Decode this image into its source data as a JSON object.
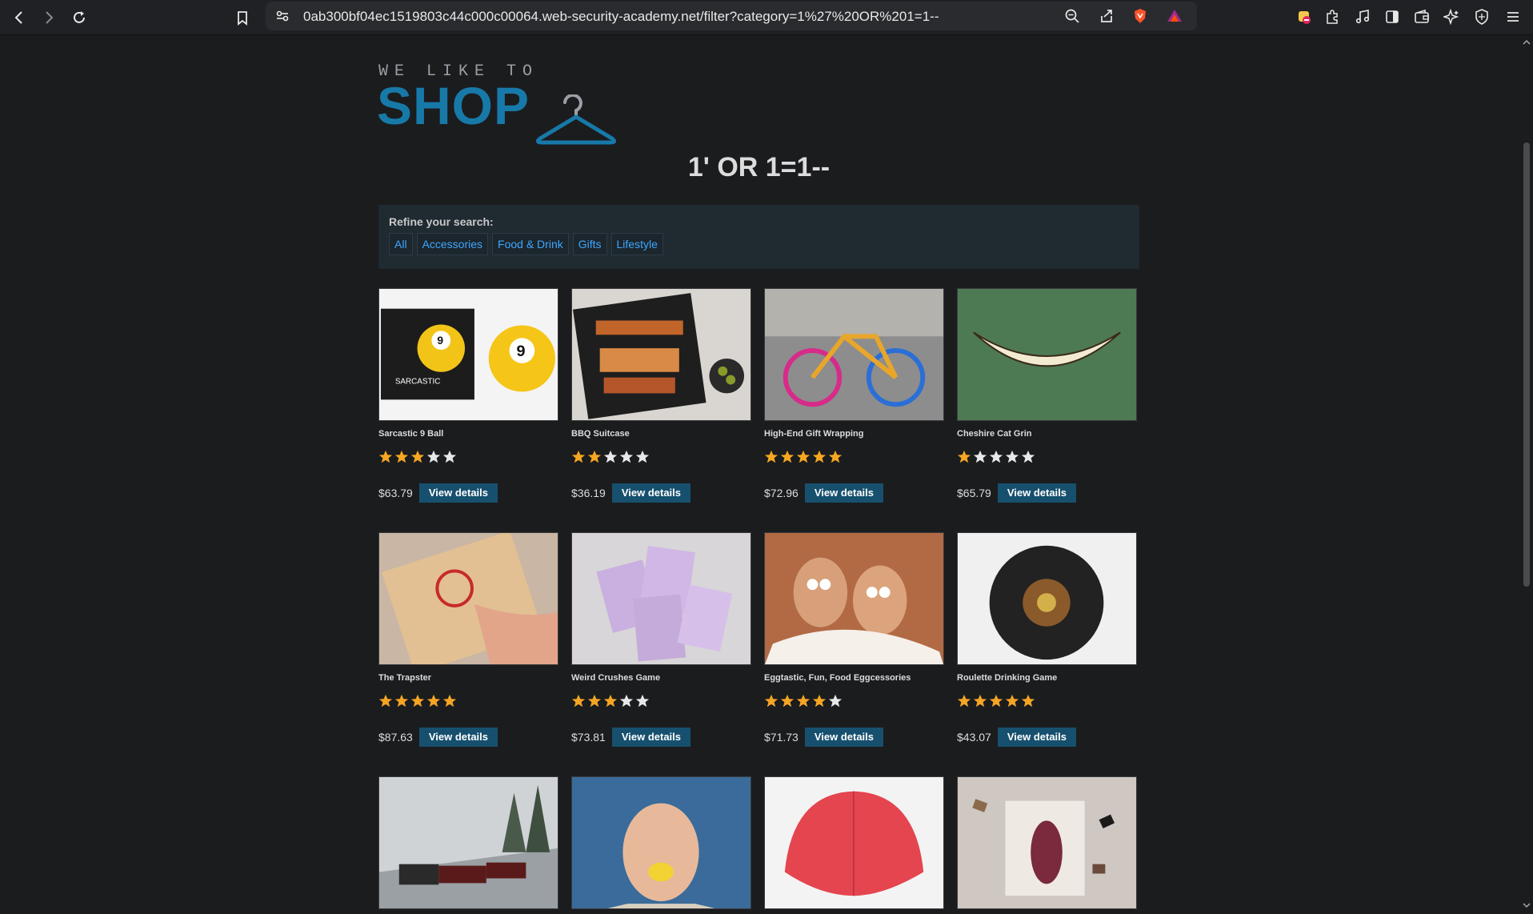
{
  "browser": {
    "url": "0ab300bf04ec1519803c44c000c00064.web-security-academy.net/filter?category=1%27%20OR%201=1--",
    "icons": [
      "back-icon",
      "forward-icon",
      "reload-icon",
      "bookmark-icon",
      "site-settings-icon",
      "zoom-icon",
      "share-icon",
      "brave-shields-icon",
      "brave-rewards-icon",
      "extension-badge-icon",
      "extensions-icon",
      "media-icon",
      "sidebar-icon",
      "wallet-icon",
      "leo-ai-icon",
      "vpn-icon",
      "menu-icon"
    ]
  },
  "logo": {
    "tagline": "WE LIKE TO",
    "word": "SHOP"
  },
  "page": {
    "title": "1' OR 1=1--"
  },
  "refine": {
    "label": "Refine your search:",
    "filters": [
      "All",
      "Accessories",
      "Food & Drink",
      "Gifts",
      "Lifestyle"
    ]
  },
  "products": [
    {
      "name": "Sarcastic 9 Ball",
      "rating": 3,
      "price": "$63.79",
      "button": "View details",
      "image": "sarcastic-9-ball-image"
    },
    {
      "name": "BBQ Suitcase",
      "rating": 2,
      "price": "$36.19",
      "button": "View details",
      "image": "bbq-grill-image"
    },
    {
      "name": "High-End Gift Wrapping",
      "rating": 5,
      "price": "$72.96",
      "button": "View details",
      "image": "knitted-bicycle-image"
    },
    {
      "name": "Cheshire Cat Grin",
      "rating": 1,
      "price": "$65.79",
      "button": "View details",
      "image": "cheshire-grin-image"
    },
    {
      "name": "The Trapster",
      "rating": 5,
      "price": "$87.63",
      "button": "View details",
      "image": "mousetrap-image"
    },
    {
      "name": "Weird Crushes Game",
      "rating": 3,
      "price": "$73.81",
      "button": "View details",
      "image": "trading-cards-image"
    },
    {
      "name": "Eggtastic, Fun, Food Eggcessories",
      "rating": 4,
      "price": "$71.73",
      "button": "View details",
      "image": "eggs-image"
    },
    {
      "name": "Roulette Drinking Game",
      "rating": 5,
      "price": "$43.07",
      "button": "View details",
      "image": "roulette-image"
    },
    {
      "image": "steam-train-image"
    },
    {
      "image": "lemon-face-image"
    },
    {
      "image": "red-umbrella-image"
    },
    {
      "image": "flying-books-image"
    }
  ],
  "colors": {
    "accent": "#1779a8",
    "link": "#3ea6ff",
    "button": "#17506e",
    "star_on": "#f5a623",
    "star_off": "#e8e8e8"
  }
}
